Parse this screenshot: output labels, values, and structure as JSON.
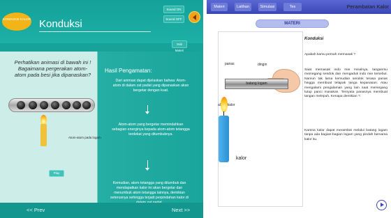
{
  "left": {
    "logo_text": "KONDUKSI\nKALOR",
    "title": "Konduksi",
    "buttons": {
      "sound_on": "Sound ON",
      "sound_off": "Sound OFF",
      "sub_materi": "Sub Materi"
    },
    "question": "Perhatikan animasi di bawah ini ! Bagaimana pergerakan atom-atom pada besi jika dipanaskan?",
    "atoms_label": "Atom-atom pada logam",
    "play_label": "Play",
    "observation": {
      "title": "Hasil Pengamatan:",
      "p1": "Dari animasi dapat dijelaskan bahwa: Atom-atom di dalam zat padat yang dipanaskan akan bergetar dengan kuat.",
      "p2": "Atom-atom yang bergetar memindahkan sebagian energinya kepada atom-atom tetangga terdekat yang ditumbuknya.",
      "p3": "Kemudian, atom tetangga yang ditumbuk dan mendapatkan kalor ini akan bergetar dan menumbuk atom tetangga lainnya, demikian seterusnya sehingga terjadi perpindahan kalor di dalam zat padat."
    },
    "nav": {
      "prev": "<< Prev",
      "next": "Next >>"
    },
    "colors": {
      "panel": "#18a39a",
      "box": "#ccede8",
      "logo": "#f2b417"
    }
  },
  "right": {
    "tabs": [
      "Materi",
      "Latihan",
      "Simulasi",
      "Tes"
    ],
    "title": "Perambatan Kalor",
    "section": "MATERI",
    "labels": {
      "panas": "panas",
      "dingin": "dingin",
      "rod": "batang logam",
      "aliran": "aliran kalor",
      "kalor": "kalor"
    },
    "heading": "Konduksi",
    "p1": "Apakah kamu pernah memasak ?",
    "p2": "Saat memasak indo mie misalnya, tanganmu memegang sendok dan mengaduk indo mie tersebut. Namun tak lama kemudian sendok terasa panas hingga membuat telapak tanga kepanasan. Atau mengalami pengalaman yang lain saat memegang tutup panci masakan. Ternyata panasnya membuat tangan melepuh. Kenapa demikian ?.",
    "p3": "Karena kalor dapat merambat melalui batang logam tanpa ada bagian-bagian logam yang pindah bersama kalor itu.",
    "colors": {
      "bar": "#3b46b6",
      "pill": "#b5bdec",
      "candle": "#2d8fd6"
    }
  }
}
